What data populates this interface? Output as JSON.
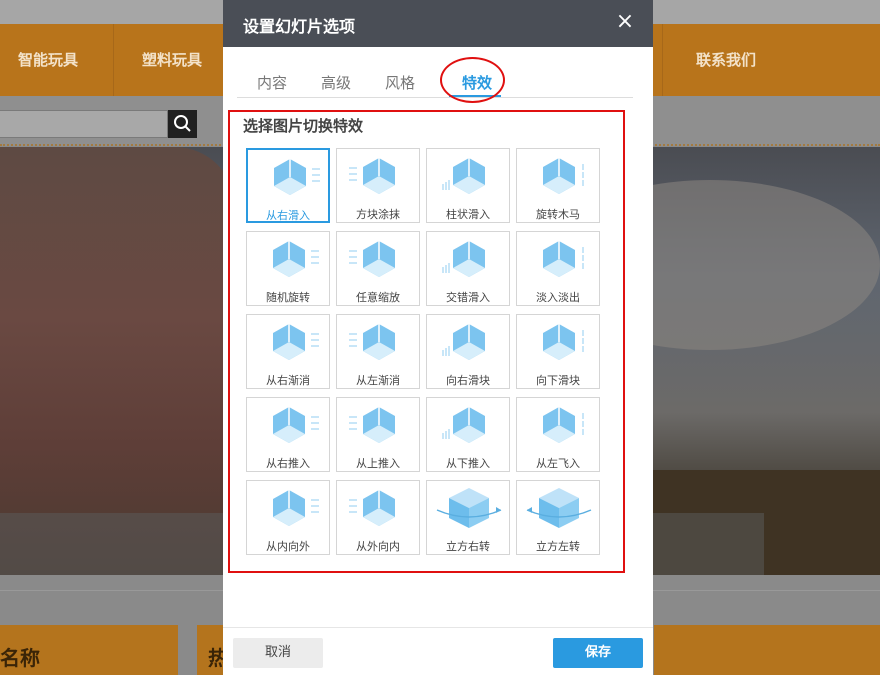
{
  "background_site": {
    "nav_items": [
      "智能玩具",
      "塑料玩具",
      "联系我们"
    ],
    "card_title": "名称",
    "card_title_2": "热"
  },
  "dialog": {
    "title": "设置幻灯片选项",
    "close_label": "×",
    "tabs": [
      {
        "label": "内容",
        "active": false
      },
      {
        "label": "高级",
        "active": false
      },
      {
        "label": "风格",
        "active": false
      },
      {
        "label": "特效",
        "active": true
      }
    ],
    "section_title": "选择图片切换特效",
    "effects": [
      {
        "label": "从右滑入",
        "selected": true,
        "icon": "cube-slide-right-icon"
      },
      {
        "label": "方块涂抹",
        "selected": false,
        "icon": "cube-smear-icon"
      },
      {
        "label": "柱状滑入",
        "selected": false,
        "icon": "cube-column-slide-icon"
      },
      {
        "label": "旋转木马",
        "selected": false,
        "icon": "cube-carousel-icon"
      },
      {
        "label": "随机旋转",
        "selected": false,
        "icon": "cube-random-rotate-icon"
      },
      {
        "label": "任意缩放",
        "selected": false,
        "icon": "cube-zoom-icon"
      },
      {
        "label": "交错滑入",
        "selected": false,
        "icon": "cube-stagger-icon"
      },
      {
        "label": "淡入淡出",
        "selected": false,
        "icon": "cube-fade-icon"
      },
      {
        "label": "从右渐消",
        "selected": false,
        "icon": "cube-fade-right-icon"
      },
      {
        "label": "从左渐消",
        "selected": false,
        "icon": "cube-fade-left-icon"
      },
      {
        "label": "向右滑块",
        "selected": false,
        "icon": "cube-block-right-icon"
      },
      {
        "label": "向下滑块",
        "selected": false,
        "icon": "cube-block-down-icon"
      },
      {
        "label": "从右推入",
        "selected": false,
        "icon": "cube-push-right-icon"
      },
      {
        "label": "从上推入",
        "selected": false,
        "icon": "cube-push-top-icon"
      },
      {
        "label": "从下推入",
        "selected": false,
        "icon": "cube-push-bottom-icon"
      },
      {
        "label": "从左飞入",
        "selected": false,
        "icon": "cube-fly-left-icon"
      },
      {
        "label": "从内向外",
        "selected": false,
        "icon": "cube-inside-out-icon"
      },
      {
        "label": "从外向内",
        "selected": false,
        "icon": "cube-outside-in-icon"
      },
      {
        "label": "立方右转",
        "selected": false,
        "icon": "cube-rotate-right-icon"
      },
      {
        "label": "立方左转",
        "selected": false,
        "icon": "cube-rotate-left-icon"
      }
    ],
    "cancel_label": "取消",
    "save_label": "保存",
    "accent_color": "#2a9ae0",
    "highlight_color": "#e01010"
  }
}
